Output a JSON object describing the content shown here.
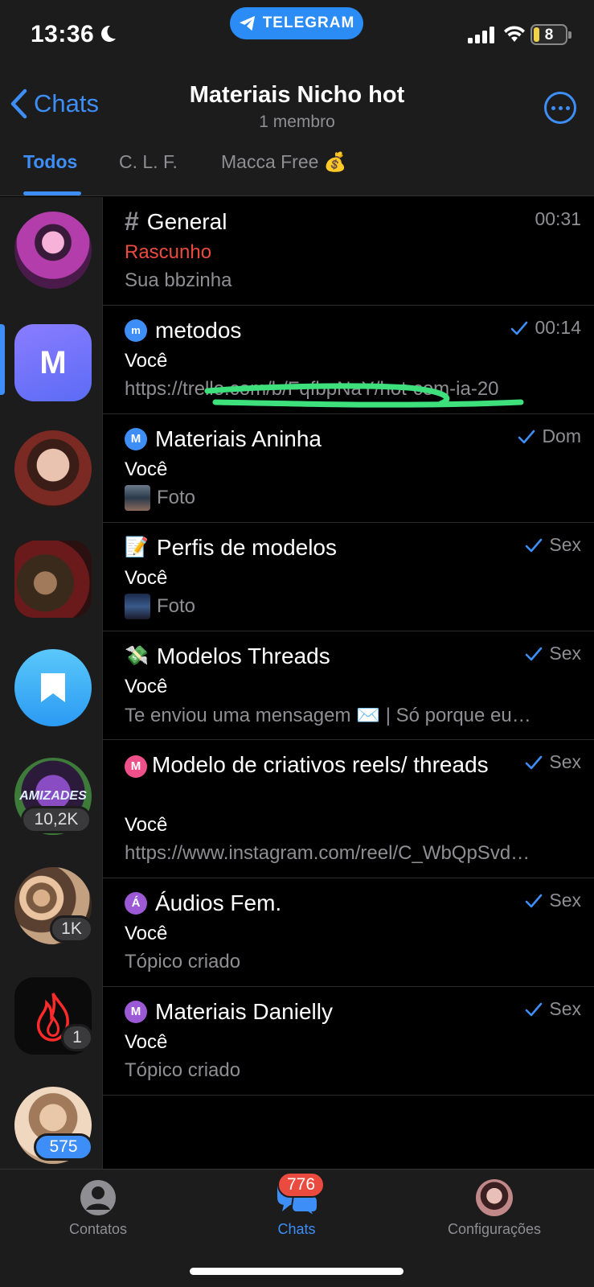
{
  "status": {
    "time": "13:36",
    "pill": "TELEGRAM",
    "battery": "8"
  },
  "header": {
    "back_label": "Chats",
    "title": "Materiais Nicho hot",
    "subtitle": "1 membro",
    "tabs": [
      "Todos",
      "C. L. F.",
      "Macca Free 💰"
    ]
  },
  "sidebar": {
    "items": [
      {
        "name": "avatar-girl-pink",
        "badge": ""
      },
      {
        "name": "avatar-m",
        "letter": "M",
        "badge": ""
      },
      {
        "name": "avatar-girl-red",
        "badge": ""
      },
      {
        "name": "avatar-monkey",
        "badge": ""
      },
      {
        "name": "avatar-saved",
        "badge": ""
      },
      {
        "name": "avatar-amizades",
        "badge": "10,2K",
        "text": "AMIZADES"
      },
      {
        "name": "avatar-group",
        "badge": "1K"
      },
      {
        "name": "avatar-fire",
        "badge": "1"
      },
      {
        "name": "avatar-woman",
        "badge": "575"
      }
    ]
  },
  "topics": [
    {
      "title": "General",
      "time": "00:31",
      "line2": "Rascunho",
      "line3": "Sua bbzinha",
      "icon": "#"
    },
    {
      "title": "metodos",
      "time": "00:14",
      "line2": "Você",
      "line3": "https://trello.com/b/FqfbpNaY/hot-com-ia-20",
      "icon": "m"
    },
    {
      "title": "Materiais Aninha",
      "time": "Dom",
      "line2": "Você",
      "line3": "Foto",
      "icon": "M"
    },
    {
      "title": "Perfis de modelos",
      "time": "Sex",
      "line2": "Você",
      "line3": "Foto",
      "icon": "📝"
    },
    {
      "title": "Modelos Threads",
      "time": "Sex",
      "line2": "Você",
      "line3": "Te enviou uma mensagem ✉️ | Só porque eu…",
      "icon": "💸"
    },
    {
      "title": "Modelo de criativos reels/ threads",
      "time": "Sex",
      "line2": "Você",
      "line3": "https://www.instagram.com/reel/C_WbQpSvd…",
      "icon": "M"
    },
    {
      "title": "Áudios Fem.",
      "time": "Sex",
      "line2": "Você",
      "line3": "Tópico criado",
      "icon": "Á"
    },
    {
      "title": "Materiais Danielly",
      "time": "Sex",
      "line2": "Você",
      "line3": "Tópico criado",
      "icon": "M"
    }
  ],
  "tabbar": {
    "contacts": "Contatos",
    "chats": "Chats",
    "settings": "Configurações",
    "unread": "776"
  },
  "colors": {
    "accent": "#3e8ef7",
    "draft": "#eb4b3f",
    "highlight": "#3ee07c"
  }
}
